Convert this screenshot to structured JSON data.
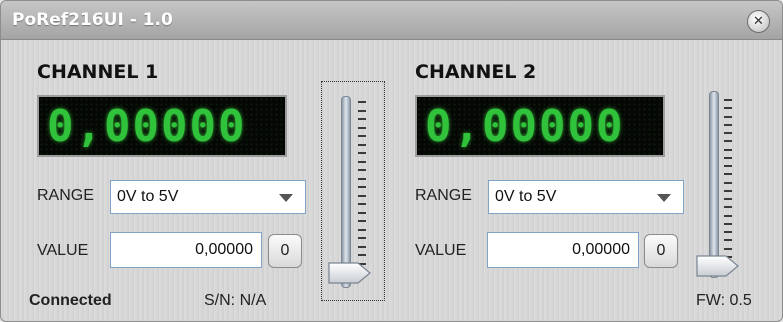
{
  "window": {
    "title": "PoRef216UI - 1.0",
    "close_glyph": "✕"
  },
  "channels": [
    {
      "title": "CHANNEL 1",
      "display": "0,00000",
      "range_label": "RANGE",
      "range_value": "0V to 5V",
      "value_label": "VALUE",
      "value": "0,00000",
      "zero_label": "0",
      "slider_level": 0
    },
    {
      "title": "CHANNEL 2",
      "display": "0,00000",
      "range_label": "RANGE",
      "range_value": "0V to 5V",
      "value_label": "VALUE",
      "value": "0,00000",
      "zero_label": "0",
      "slider_level": 0
    }
  ],
  "status": {
    "connection": "Connected",
    "serial": "S/N: N/A",
    "firmware": "FW: 0.5"
  },
  "colors": {
    "lcd_green": "#2fc23a",
    "lcd_background": "#050705",
    "title_bar": "#b4b4b4",
    "field_border": "#7fa4c8"
  },
  "icons": {
    "close": "close-icon",
    "dropdown": "chevron-down-icon",
    "slider_thumb": "slider-thumb-icon"
  }
}
